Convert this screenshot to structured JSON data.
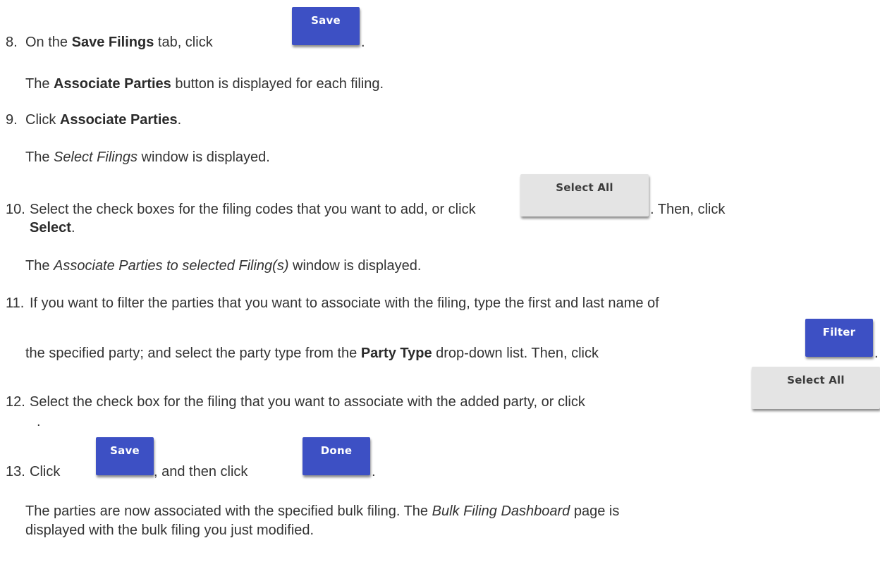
{
  "steps": {
    "s8": {
      "number": "8.",
      "pre": "On the ",
      "bold": "Save Filings",
      "post": " tab, click",
      "button": "Save",
      "end": ".",
      "result_pre": "The ",
      "result_bold": "Associate Parties",
      "result_post": " button is displayed for each filing."
    },
    "s9": {
      "number": "9.",
      "pre": "Click ",
      "bold": "Associate Parties",
      "end": ".",
      "result_pre": "The ",
      "result_italic": "Select Filings",
      "result_post": " window is displayed."
    },
    "s10": {
      "number": "10.",
      "pre": "Select the check boxes for the filing codes that you want to add, or click",
      "button": "Select All",
      "post": ". Then, click",
      "bold2": "Select",
      "end": ".",
      "result_pre": "The ",
      "result_italic": "Associate Parties to selected Filing(s)",
      "result_post": " window is displayed."
    },
    "s11": {
      "number": "11.",
      "line1": "If you want to filter the parties that you want to associate with the filing, type the first and last name of",
      "line2_pre": "the specified party; and select the party type from the ",
      "line2_bold": "Party Type",
      "line2_post": " drop-down list. Then, click",
      "button": "Filter",
      "end": "."
    },
    "s12": {
      "number": "12.",
      "text": "Select the check box for the filing that you want to associate with the added party, or click",
      "button": "Select All",
      "end": "."
    },
    "s13": {
      "number": "13.",
      "pre": "Click",
      "button1": "Save",
      "mid": ", and then click",
      "button2": "Done",
      "end": ".",
      "result_line1_pre": "The parties are now associated with the specified bulk filing. The ",
      "result_line1_italic": "Bulk Filing Dashboard",
      "result_line1_post": " page is",
      "result_line2": "displayed with the bulk filing you just modified."
    }
  }
}
